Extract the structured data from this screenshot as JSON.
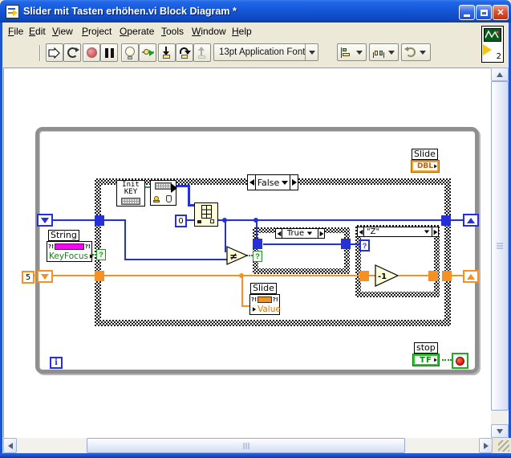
{
  "titlebar": {
    "title": "Slider mit Tasten erhöhen.vi Block Diagram *",
    "close_glyph": "✕"
  },
  "menu": {
    "items": [
      "File",
      "Edit",
      "View",
      "Project",
      "Operate",
      "Tools",
      "Window",
      "Help"
    ]
  },
  "toolbar": {
    "font_selector": "13pt Application Font",
    "help_label": "?",
    "vi_badge": "2",
    "pause_glyph": "❚❚"
  },
  "diagram": {
    "loop_iteration": "i",
    "cases": {
      "outer": "False",
      "inner_true": "True",
      "inner_z": "\"Z\""
    },
    "constants": {
      "zero": "0",
      "five": "5"
    },
    "nodes": {
      "init_key_line1": "Init",
      "init_key_line2": "KEY",
      "not_equal": "≠",
      "decrement": "-1"
    },
    "property_nodes": {
      "string": {
        "label": "String",
        "property": "KeyFocus",
        "glyph": "?!"
      },
      "slide": {
        "label": "Slide",
        "property": "Value",
        "glyph": "?!"
      }
    },
    "terminals": {
      "slide": {
        "label": "Slide",
        "type": "DBL"
      },
      "stop": {
        "label": "stop",
        "type": "TF"
      }
    },
    "tunnels": {
      "selector_q": "?"
    }
  },
  "colors": {
    "wire_blue": "#2630d8",
    "wire_orange": "#f59122",
    "wire_green": "#1e9a1e",
    "wire_teal": "#2f9090",
    "string_pink": "#ff00ff",
    "node_yellow": "#ffffd8",
    "loop_gray": "#8f8f8f"
  }
}
